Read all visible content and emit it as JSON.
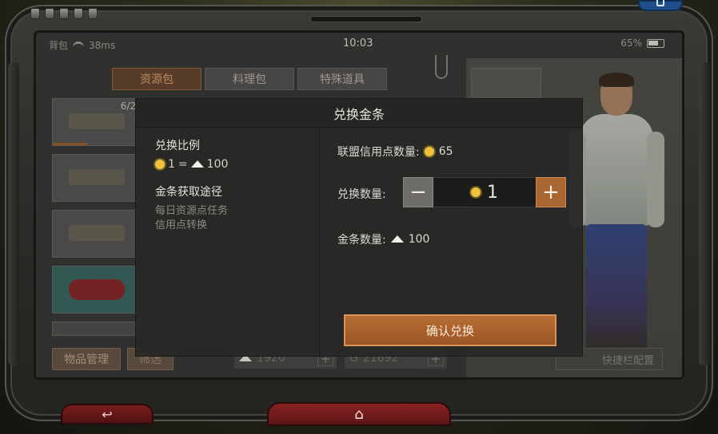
{
  "status": {
    "carrier": "背包",
    "ping": "38ms",
    "time": "10:03",
    "battery": "65%"
  },
  "tabs": [
    {
      "label": "资源包",
      "active": true
    },
    {
      "label": "料理包",
      "active": false
    },
    {
      "label": "特殊道具",
      "active": false
    }
  ],
  "inventory": {
    "items": [
      {
        "count": "6/2"
      },
      {
        "count": ""
      },
      {
        "count": ""
      },
      {
        "count": ""
      }
    ]
  },
  "bottom": {
    "manage_label": "物品管理",
    "filter_label": "筛选",
    "gold_amount": "1920",
    "coin_amount": "21692",
    "quickbar_label": "快捷栏配置"
  },
  "modal": {
    "title": "兑换金条",
    "ratio_heading": "兑换比例",
    "ratio_credit": "1",
    "ratio_eq": "=",
    "ratio_gold": "100",
    "source_heading": "金条获取途径",
    "source_line1": "每日资源点任务",
    "source_line2": "信用点转换",
    "credit_label": "联盟信用点数量:",
    "credit_value": "65",
    "amount_label": "兑换数量:",
    "amount_value": "1",
    "gold_label": "金条数量:",
    "gold_value": "100",
    "confirm_label": "确认兑换"
  },
  "colors": {
    "accent": "#b86d34",
    "credit_icon": "#f0c23a"
  }
}
